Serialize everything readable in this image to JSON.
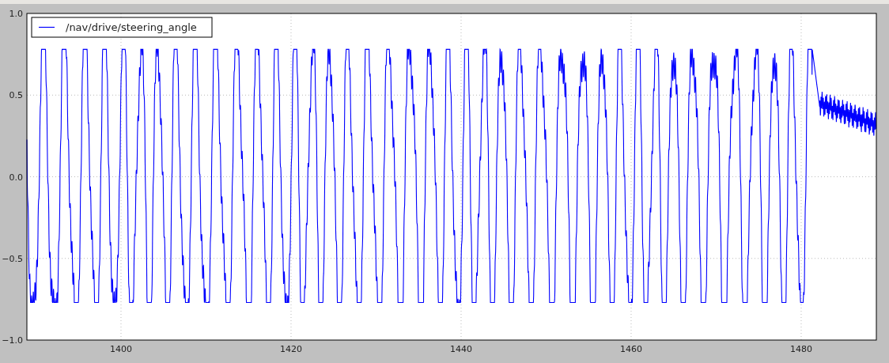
{
  "plot": {
    "legend": {
      "label": "/nav/drive/steering_angle",
      "color": "#0000ff"
    },
    "yticks": [
      "1.0",
      "0.5",
      "0.0",
      "−0.5",
      "−1.0"
    ],
    "xticks": [
      "1400",
      "1420",
      "1440",
      "1460",
      "1480"
    ]
  }
}
